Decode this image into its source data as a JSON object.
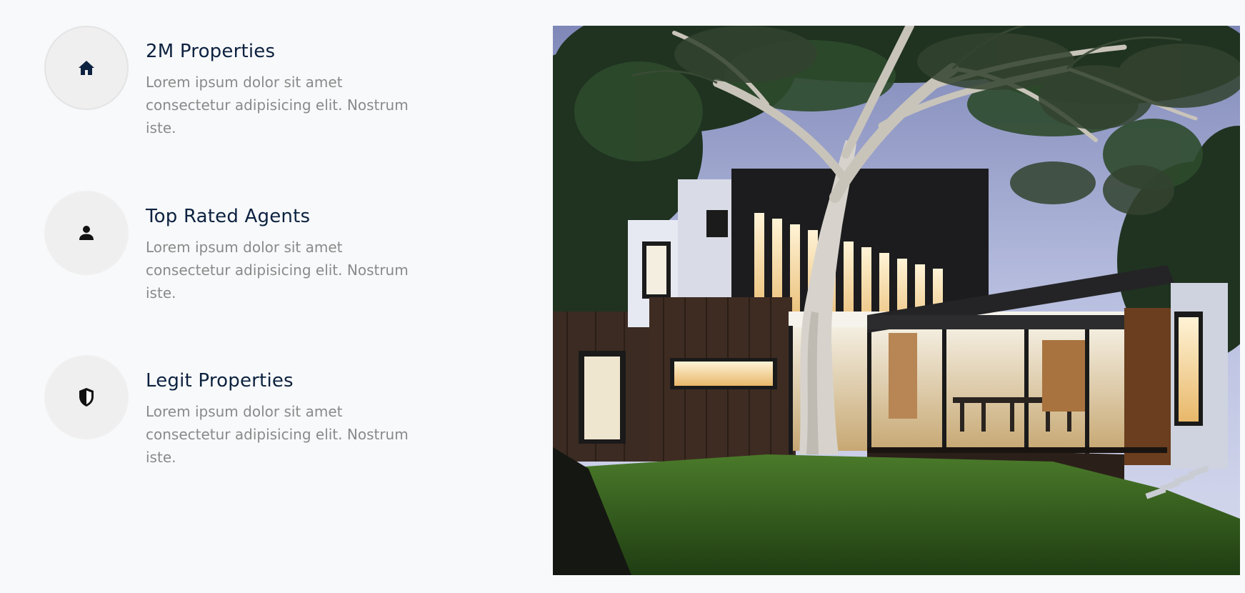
{
  "features": [
    {
      "icon": "home-icon",
      "title": "2M Properties",
      "description": "Lorem ipsum dolor sit amet consectetur adipisicing elit. Nostrum iste."
    },
    {
      "icon": "user-icon",
      "title": "Top Rated Agents",
      "description": "Lorem ipsum dolor sit amet consectetur adipisicing elit. Nostrum iste."
    },
    {
      "icon": "shield-icon",
      "title": "Legit Properties",
      "description": "Lorem ipsum dolor sit amet consectetur adipisicing elit. Nostrum iste."
    }
  ],
  "image": {
    "subject": "modern-house-photo"
  },
  "colors": {
    "heading": "#0d2240",
    "body_text": "#8a8a8a",
    "icon_circle": "#efefef",
    "page_background": "#f8f9fa"
  }
}
